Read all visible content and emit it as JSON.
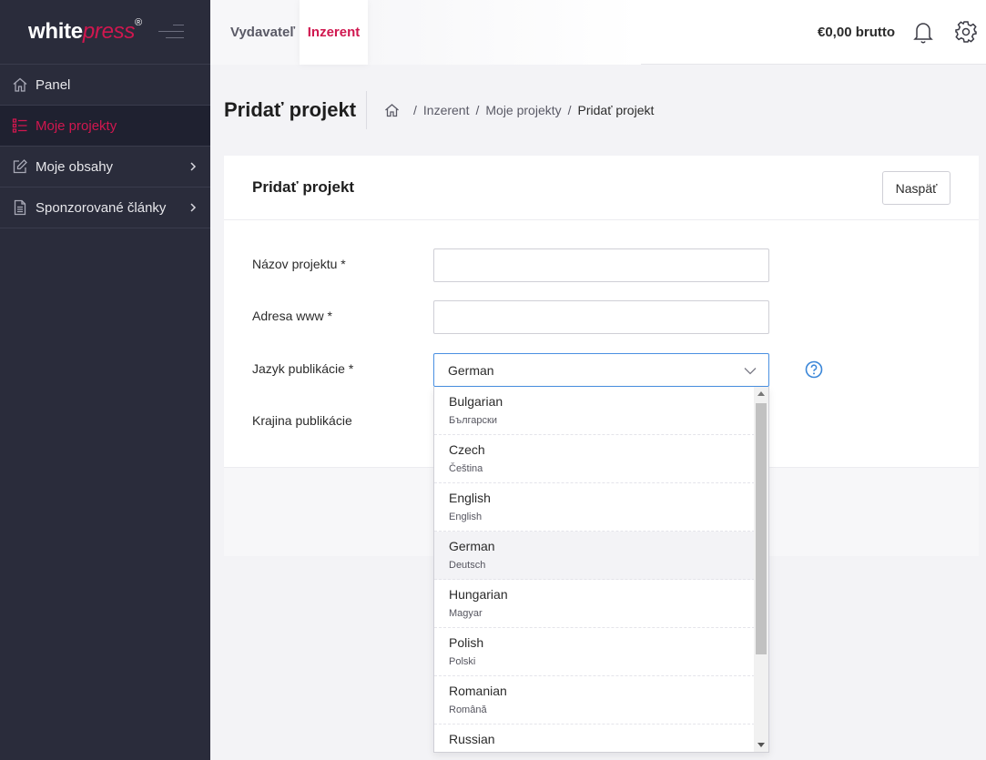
{
  "app": {
    "logo_white": "white",
    "logo_press": "press",
    "logo_reg": "®"
  },
  "sidebar": {
    "items": [
      {
        "label": "Panel",
        "icon": "home-icon"
      },
      {
        "label": "Moje projekty",
        "icon": "list-icon",
        "active": true
      },
      {
        "label": "Moje obsahy",
        "icon": "edit-icon"
      },
      {
        "label": "Sponzorované články",
        "icon": "document-icon"
      }
    ]
  },
  "header": {
    "tabs": [
      {
        "label": "Vydavateľ"
      },
      {
        "label": "Inzerent",
        "active": true
      }
    ],
    "balance": "€0,00 brutto"
  },
  "page": {
    "title": "Pridať projekt",
    "breadcrumb": [
      "Inzerent",
      "Moje projekty",
      "Pridať projekt"
    ],
    "breadcrumb_sep": "/"
  },
  "card": {
    "title": "Pridať projekt",
    "back_label": "Naspäť"
  },
  "form": {
    "fields": [
      {
        "label": "Názov projektu *",
        "value": ""
      },
      {
        "label": "Adresa www *",
        "value": ""
      },
      {
        "label": "Jazyk publikácie *",
        "value": "German"
      },
      {
        "label": "Krajina publikácie",
        "value": ""
      }
    ]
  },
  "dropdown": {
    "options": [
      {
        "name": "Bulgarian",
        "native": "Български"
      },
      {
        "name": "Czech",
        "native": "Čeština"
      },
      {
        "name": "English",
        "native": "English"
      },
      {
        "name": "German",
        "native": "Deutsch",
        "highlighted": true
      },
      {
        "name": "Hungarian",
        "native": "Magyar"
      },
      {
        "name": "Polish",
        "native": "Polski"
      },
      {
        "name": "Romanian",
        "native": "Română"
      },
      {
        "name": "Russian",
        "native": ""
      }
    ]
  },
  "colors": {
    "brand": "#d0174f",
    "sidebar_bg": "#2a2c3b",
    "focus": "#4a90e2"
  }
}
